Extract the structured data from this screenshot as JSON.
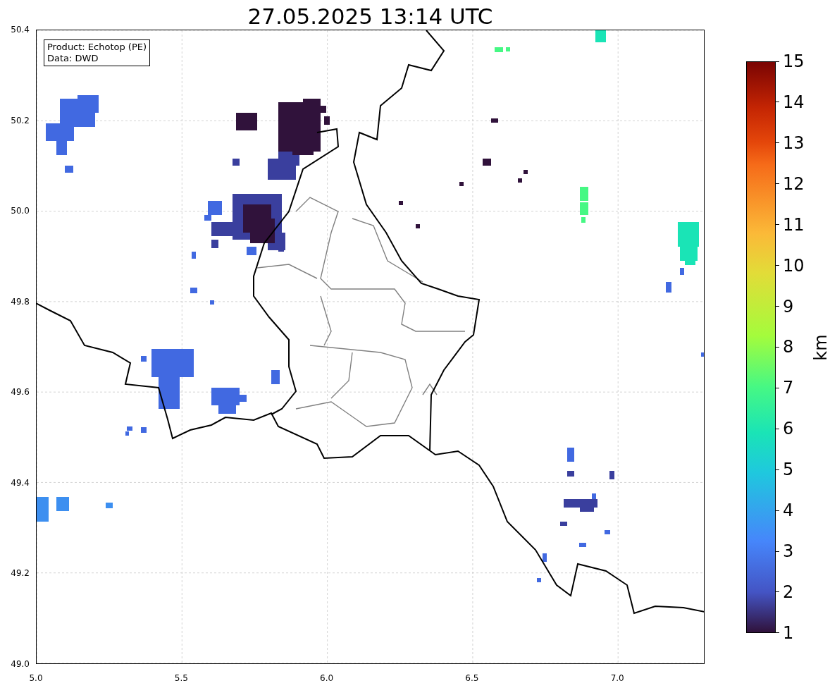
{
  "title": "27.05.2025 13:14 UTC",
  "legend_box": [
    "Product: Echotop (PE)",
    "Data: DWD"
  ],
  "x_ticks": [
    "5.0",
    "5.5",
    "6.0",
    "6.5",
    "7.0"
  ],
  "y_ticks": [
    "50.4",
    "50.2",
    "50.0",
    "49.8",
    "49.6",
    "49.4",
    "49.2",
    "49.0"
  ],
  "colorbar": {
    "ticks": [
      "15",
      "14",
      "13",
      "12",
      "11",
      "10",
      "9",
      "8",
      "7",
      "6",
      "5",
      "4",
      "3",
      "2",
      "1"
    ],
    "label": "km"
  }
}
